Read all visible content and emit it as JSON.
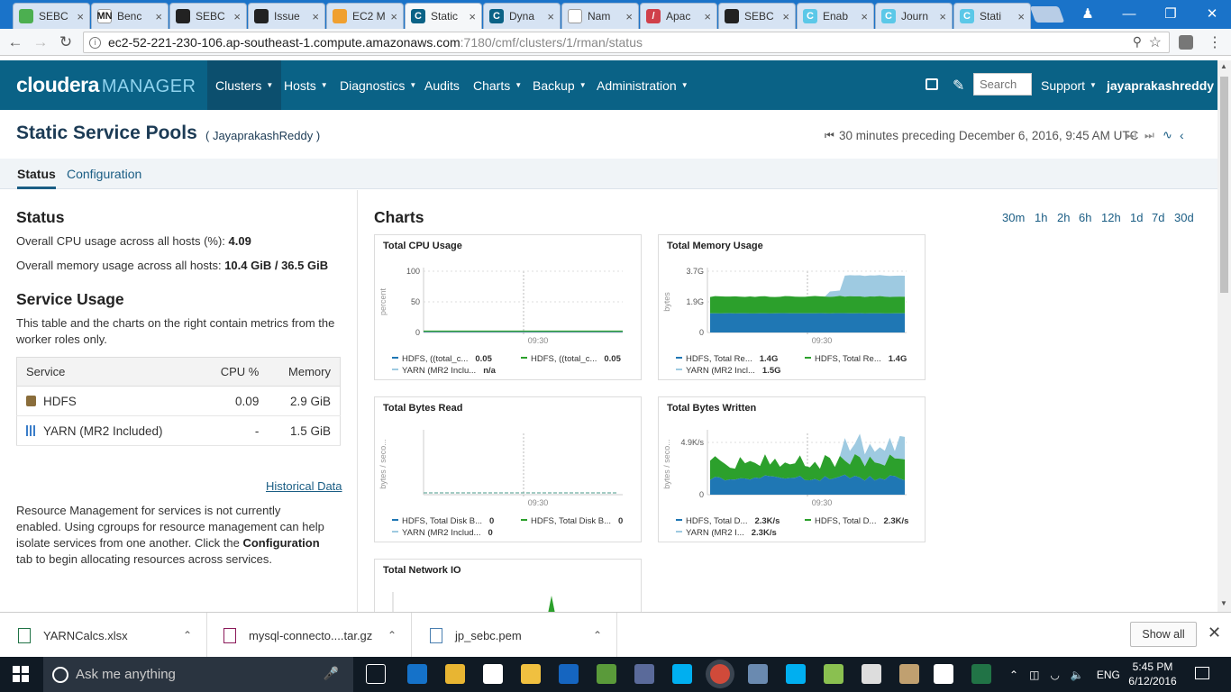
{
  "browser": {
    "tabs": [
      {
        "label": "SEBC",
        "icon_color": "#4caf50",
        "icon_text": "",
        "active": false
      },
      {
        "label": "Benc",
        "icon_color": "#ffffff",
        "icon_text": "MN",
        "active": false
      },
      {
        "label": "SEBC",
        "icon_color": "#222222",
        "icon_text": "",
        "active": false
      },
      {
        "label": "Issue",
        "icon_color": "#222222",
        "icon_text": "",
        "active": false
      },
      {
        "label": "EC2 M",
        "icon_color": "#f0a030",
        "icon_text": "",
        "active": false
      },
      {
        "label": "Static",
        "icon_color": "#0a6286",
        "icon_text": "C",
        "active": true
      },
      {
        "label": "Dyna",
        "icon_color": "#0a6286",
        "icon_text": "C",
        "active": false
      },
      {
        "label": "Nam",
        "icon_color": "#ffffff",
        "icon_text": "",
        "active": false
      },
      {
        "label": "Apac",
        "icon_color": "#d0404a",
        "icon_text": "/",
        "active": false
      },
      {
        "label": "SEBC",
        "icon_color": "#222222",
        "icon_text": "",
        "active": false
      },
      {
        "label": "Enab",
        "icon_color": "#5bc8e8",
        "icon_text": "C",
        "active": false
      },
      {
        "label": "Journ",
        "icon_color": "#5bc8e8",
        "icon_text": "C",
        "active": false
      },
      {
        "label": "Stati",
        "icon_color": "#5bc8e8",
        "icon_text": "C",
        "active": false
      }
    ],
    "url_host": "ec2-52-221-230-106.ap-southeast-1.compute.amazonaws.com",
    "url_path": ":7180/cmf/clusters/1/rman/status",
    "close_glyph": "×"
  },
  "header": {
    "logo_word": "cloudera",
    "logo_manager": "MANAGER",
    "nav": [
      {
        "label": "Clusters",
        "caret": true,
        "active": true
      },
      {
        "label": "Hosts",
        "caret": true,
        "active": false
      },
      {
        "label": "Diagnostics",
        "caret": true,
        "active": false
      },
      {
        "label": "Audits",
        "caret": false,
        "active": false
      },
      {
        "label": "Charts",
        "caret": true,
        "active": false
      },
      {
        "label": "Backup",
        "caret": true,
        "active": false
      },
      {
        "label": "Administration",
        "caret": true,
        "active": false
      }
    ],
    "search_placeholder": "Search",
    "support": "Support",
    "user": "jayaprakashreddy"
  },
  "page": {
    "title": "Static Service Pools",
    "cluster": "( JayaprakashReddy )",
    "time_range": "30 minutes preceding December 6, 2016, 9:45 AM UTC",
    "subtabs": [
      "Status",
      "Configuration"
    ]
  },
  "status": {
    "heading": "Status",
    "cpu_label": "Overall CPU usage across all hosts (%): ",
    "cpu_value": "4.09",
    "mem_label": "Overall memory usage across all hosts: ",
    "mem_value": "10.4 GiB / 36.5 GiB"
  },
  "service_usage": {
    "heading": "Service Usage",
    "description": "This table and the charts on the right contain metrics from the worker roles only.",
    "columns": [
      "Service",
      "CPU %",
      "Memory"
    ],
    "rows": [
      {
        "service": "HDFS",
        "cpu": "0.09",
        "memory": "2.9 GiB",
        "icon_color": "#8a6d3b"
      },
      {
        "service": "YARN (MR2 Included)",
        "cpu": "-",
        "memory": "1.5 GiB",
        "icon_color": "#3a7dc9"
      }
    ],
    "historical_link": "Historical Data",
    "note_before": "Resource Management for services is not currently enabled. Using cgroups for resource management can help isolate services from one another. Click the ",
    "note_bold": "Configuration",
    "note_after": " tab to begin allocating resources across services."
  },
  "charts": {
    "heading": "Charts",
    "ranges": [
      "30m",
      "1h",
      "2h",
      "6h",
      "12h",
      "1d",
      "7d",
      "30d"
    ],
    "colors": {
      "hdfs1": "#1f77b4",
      "hdfs2": "#2ca02c",
      "yarn": "#9ecae1"
    },
    "tick_time": "09:30"
  },
  "chart_data": [
    {
      "type": "line",
      "title": "Total CPU Usage",
      "ylabel": "percent",
      "yticks": [
        "100",
        "50",
        "0"
      ],
      "ylim": [
        0,
        100
      ],
      "x_tick": "09:30",
      "series": [
        {
          "name": "HDFS, ((total_c...",
          "value": "0.05",
          "color": "#1f77b4"
        },
        {
          "name": "HDFS, ((total_c...",
          "value": "0.05",
          "color": "#2ca02c"
        },
        {
          "name": "YARN (MR2 Inclu...",
          "value": "n/a",
          "color": "#9ecae1"
        }
      ]
    },
    {
      "type": "area",
      "title": "Total Memory Usage",
      "ylabel": "bytes",
      "yticks": [
        "3.7G",
        "1.9G",
        "0"
      ],
      "x_tick": "09:30",
      "series": [
        {
          "name": "HDFS, Total Re...",
          "value": "1.4G",
          "color": "#1f77b4"
        },
        {
          "name": "HDFS, Total Re...",
          "value": "1.4G",
          "color": "#2ca02c"
        },
        {
          "name": "YARN (MR2 Incl...",
          "value": "1.5G",
          "color": "#9ecae1"
        }
      ]
    },
    {
      "type": "line",
      "title": "Total Bytes Read",
      "ylabel": "bytes / seco...",
      "yticks": [],
      "x_tick": "09:30",
      "series": [
        {
          "name": "HDFS, Total Disk B...",
          "value": "0",
          "color": "#1f77b4"
        },
        {
          "name": "HDFS, Total Disk B...",
          "value": "0",
          "color": "#2ca02c"
        },
        {
          "name": "YARN (MR2 Includ...",
          "value": "0",
          "color": "#9ecae1"
        }
      ]
    },
    {
      "type": "area",
      "title": "Total Bytes Written",
      "ylabel": "bytes / seco...",
      "yticks": [
        "4.9K/s",
        "0"
      ],
      "x_tick": "09:30",
      "series": [
        {
          "name": "HDFS, Total D...",
          "value": "2.3K/s",
          "color": "#1f77b4"
        },
        {
          "name": "HDFS, Total D...",
          "value": "2.3K/s",
          "color": "#2ca02c"
        },
        {
          "name": "YARN (MR2 I...",
          "value": "2.3K/s",
          "color": "#9ecae1"
        }
      ]
    },
    {
      "type": "area",
      "title": "Total Network IO",
      "ylabel": "",
      "yticks": [],
      "series": []
    }
  ],
  "downloads": {
    "items": [
      "YARNCalcs.xlsx",
      "mysql-connecto....tar.gz",
      "jp_sebc.pem"
    ],
    "show_all": "Show all"
  },
  "taskbar": {
    "search_placeholder": "Ask me anything",
    "lang": "ENG",
    "time": "5:45 PM",
    "date": "6/12/2016"
  }
}
